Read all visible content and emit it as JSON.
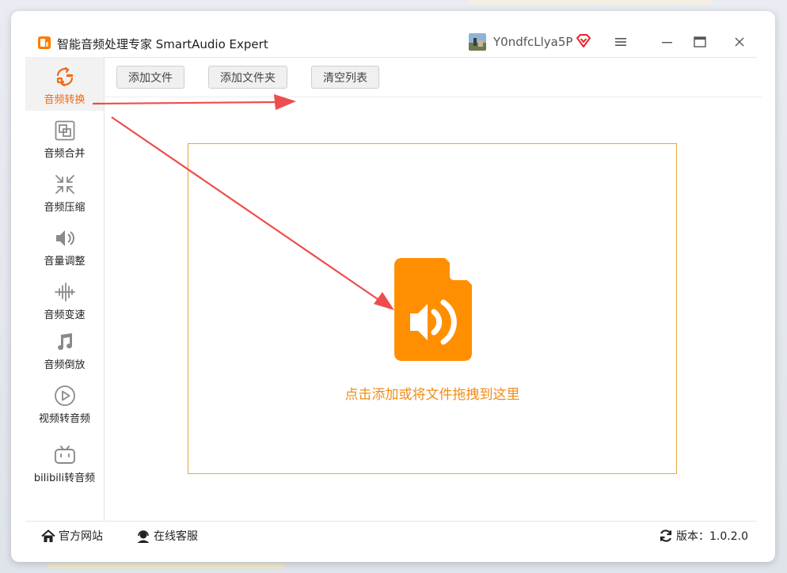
{
  "window": {
    "title": "智能音频处理专家 SmartAudio Expert",
    "username": "Y0ndfcLlya5P"
  },
  "colors": {
    "accent": "#f06a10",
    "file_icon": "#ff8f00",
    "dropzone_border": "#e3a63c",
    "drop_text": "#f08c16",
    "annotation_arrow": "#ee4d4d"
  },
  "toolbar": {
    "add_file": "添加文件",
    "add_folder": "添加文件夹",
    "clear_list": "清空列表"
  },
  "sidebar": {
    "items": [
      {
        "label": "音频转换",
        "icon": "convert-icon",
        "active": true
      },
      {
        "label": "音频合并",
        "icon": "merge-icon",
        "active": false
      },
      {
        "label": "音频压缩",
        "icon": "compress-icon",
        "active": false
      },
      {
        "label": "音量调整",
        "icon": "volume-icon",
        "active": false
      },
      {
        "label": "音频变速",
        "icon": "waveform-icon",
        "active": false
      },
      {
        "label": "音频倒放",
        "icon": "music-note-icon",
        "active": false
      },
      {
        "label": "视频转音频",
        "icon": "play-icon",
        "active": false
      },
      {
        "label": "bilibili转音频",
        "icon": "bilibili-icon",
        "active": false
      }
    ]
  },
  "dropzone": {
    "text": "点击添加或将文件拖拽到这里"
  },
  "footer": {
    "website": "官方网站",
    "service": "在线客服",
    "version": "版本：1.0.2.0"
  }
}
